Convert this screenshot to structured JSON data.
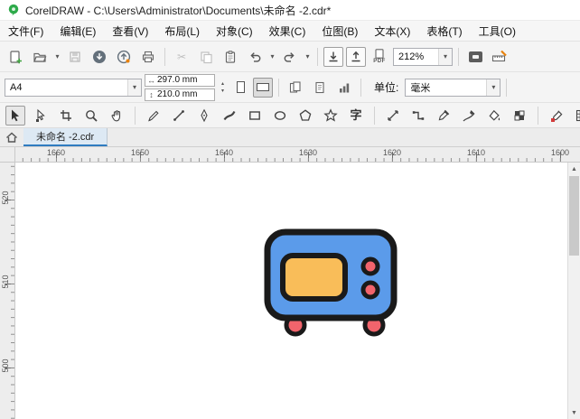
{
  "window": {
    "title": "CorelDRAW - C:\\Users\\Administrator\\Documents\\未命名 -2.cdr*"
  },
  "menu": {
    "items": [
      "文件(F)",
      "编辑(E)",
      "查看(V)",
      "布局(L)",
      "对象(C)",
      "效果(C)",
      "位图(B)",
      "文本(X)",
      "表格(T)",
      "工具(O)"
    ]
  },
  "toolbar": {
    "zoom_value": "212%",
    "pdf_label": "PDF"
  },
  "property_bar": {
    "page_size": "A4",
    "page_width": "297.0 mm",
    "page_height": "210.0 mm",
    "units_label": "单位:",
    "units_value": "毫米"
  },
  "toolbox": {
    "text_tool_glyph": "字"
  },
  "document_tab": {
    "label": "未命名 -2.cdr"
  },
  "rulers": {
    "horizontal_labels": [
      "1660",
      "1650",
      "1640",
      "1630",
      "1620",
      "1610",
      "1600"
    ],
    "vertical_labels": [
      "520",
      "510",
      "500"
    ]
  },
  "icons": {
    "dropdown": "▾",
    "spin_up": "▴",
    "spin_down": "▾",
    "scroll_up": "▲",
    "scroll_down": "▼",
    "width_arrows": "↔",
    "height_arrows": "↕",
    "scissors": "✂"
  },
  "artwork": {
    "body_color": "#5B9BEA",
    "screen_color": "#F9BD59",
    "accent_color": "#F2646C",
    "outline_color": "#1A1A1A"
  }
}
